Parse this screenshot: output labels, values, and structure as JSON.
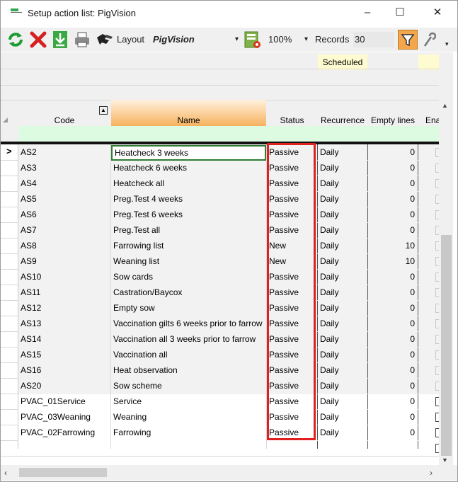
{
  "window": {
    "title": "Setup action list: PigVision",
    "minimize": "–",
    "maximize": "☐",
    "close": "✕"
  },
  "toolbar": {
    "layout_label": "Layout",
    "layout_value": "PigVision",
    "zoom_value": "100%",
    "records_label": "Records",
    "records_value": "30",
    "colors": {
      "refresh": "#1e9b35",
      "delete": "#d62020",
      "download": "#3aa845",
      "filter_bg": "#f3a64c"
    }
  },
  "grid": {
    "scheduled_label": "Scheduled",
    "columns": {
      "code": "Code",
      "name": "Name",
      "status": "Status",
      "recurrence": "Recurrence",
      "empty_lines": "Empty lines",
      "enabled_partial": "Ena"
    },
    "rows": [
      {
        "code": "AS2",
        "name": "Heatcheck 3 weeks",
        "status": "Passive",
        "recurrence": "Daily",
        "empty": "0",
        "checked": true
      },
      {
        "code": "AS3",
        "name": "Heatcheck 6 weeks",
        "status": "Passive",
        "recurrence": "Daily",
        "empty": "0",
        "checked": true
      },
      {
        "code": "AS4",
        "name": "Heatcheck all",
        "status": "Passive",
        "recurrence": "Daily",
        "empty": "0",
        "checked": true
      },
      {
        "code": "AS5",
        "name": "Preg.Test 4 weeks",
        "status": "Passive",
        "recurrence": "Daily",
        "empty": "0",
        "checked": true
      },
      {
        "code": "AS6",
        "name": "Preg.Test 6 weeks",
        "status": "Passive",
        "recurrence": "Daily",
        "empty": "0",
        "checked": true
      },
      {
        "code": "AS7",
        "name": "Preg.Test all",
        "status": "Passive",
        "recurrence": "Daily",
        "empty": "0",
        "checked": true
      },
      {
        "code": "AS8",
        "name": "Farrowing list",
        "status": "New",
        "recurrence": "Daily",
        "empty": "10",
        "checked": true
      },
      {
        "code": "AS9",
        "name": "Weaning list",
        "status": "New",
        "recurrence": "Daily",
        "empty": "10",
        "checked": true
      },
      {
        "code": "AS10",
        "name": "Sow cards",
        "status": "Passive",
        "recurrence": "Daily",
        "empty": "0",
        "checked": false
      },
      {
        "code": "AS11",
        "name": "Castration/Baycox",
        "status": "Passive",
        "recurrence": "Daily",
        "empty": "0",
        "checked": true
      },
      {
        "code": "AS12",
        "name": "Empty sow",
        "status": "Passive",
        "recurrence": "Daily",
        "empty": "0",
        "checked": true
      },
      {
        "code": "AS13",
        "name": "Vaccination gilts 6 weeks prior to farrow",
        "status": "Passive",
        "recurrence": "Daily",
        "empty": "0",
        "checked": true
      },
      {
        "code": "AS14",
        "name": "Vaccination all 3 weeks prior to farrow",
        "status": "Passive",
        "recurrence": "Daily",
        "empty": "0",
        "checked": true
      },
      {
        "code": "AS15",
        "name": "Vaccination all",
        "status": "Passive",
        "recurrence": "Daily",
        "empty": "0",
        "checked": true
      },
      {
        "code": "AS16",
        "name": "Heat observation",
        "status": "Passive",
        "recurrence": "Daily",
        "empty": "0",
        "checked": true
      },
      {
        "code": "AS20",
        "name": "Sow scheme",
        "status": "Passive",
        "recurrence": "Daily",
        "empty": "0",
        "checked": true
      },
      {
        "code": "PVAC_01Service",
        "name": "Service",
        "status": "Passive",
        "recurrence": "Daily",
        "empty": "0",
        "checked": false
      },
      {
        "code": "PVAC_03Weaning",
        "name": "Weaning",
        "status": "Passive",
        "recurrence": "Daily",
        "empty": "0",
        "checked": false
      },
      {
        "code": "PVAC_02Farrowing",
        "name": "Farrowing",
        "status": "Passive",
        "recurrence": "Daily",
        "empty": "0",
        "checked": false
      }
    ],
    "highlight_color": "#e0201e"
  }
}
